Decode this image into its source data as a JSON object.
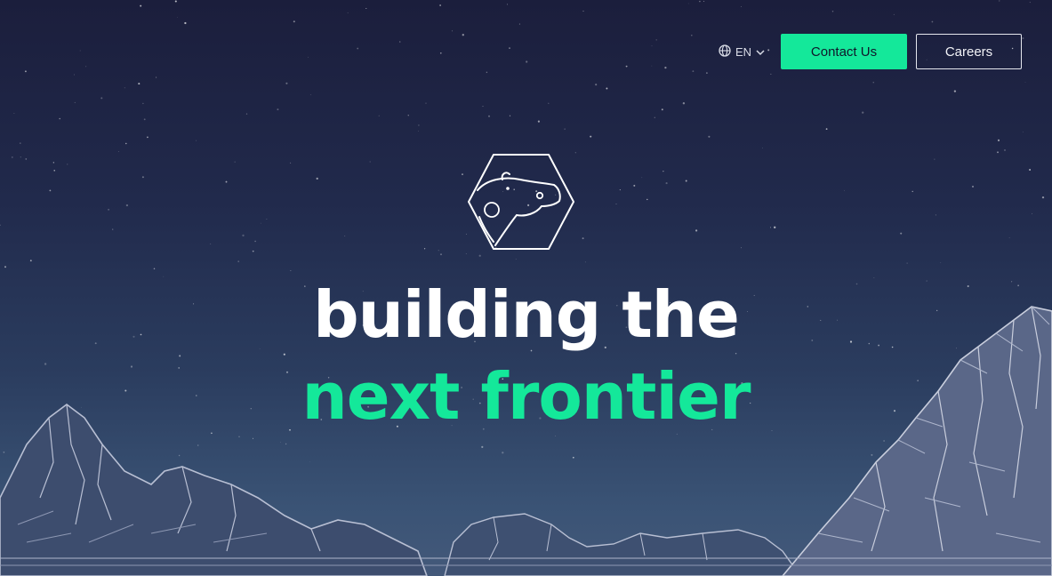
{
  "header": {
    "language": "EN",
    "contact_label": "Contact Us",
    "careers_label": "Careers"
  },
  "hero": {
    "headline_line1": "building the",
    "headline_line2": "next frontier"
  },
  "icons": {
    "language": "globe-icon",
    "dropdown": "chevron-down-icon",
    "logo": "polar-bear-hexagon-logo"
  },
  "colors": {
    "accent": "#14e89a",
    "background_top": "#1b1e3c",
    "background_bottom": "#44597a",
    "mountain_line": "#aeb6cc"
  }
}
